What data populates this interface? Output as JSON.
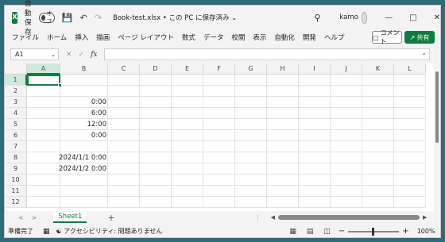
{
  "titlebar": {
    "logo": "X",
    "autosave_label": "自動保存",
    "autosave_state": "オフ",
    "doc_title": "Book-test.xlsx • この PC に保存済み ⌄",
    "user_name": "kamo"
  },
  "icons": {
    "save": "save-icon",
    "undo": "undo-icon",
    "redo": "redo-icon",
    "search": "search-icon",
    "minimize": "minimize-icon",
    "maximize": "maximize-icon",
    "close": "close-icon"
  },
  "menu": {
    "items": [
      "ファイル",
      "ホーム",
      "挿入",
      "描画",
      "ページ レイアウト",
      "数式",
      "データ",
      "校閲",
      "表示",
      "自動化",
      "開発",
      "ヘルプ"
    ],
    "comment_label": "コメント",
    "share_label": "共有"
  },
  "formula_bar": {
    "name_box": "A1",
    "fx_label": "fx",
    "content": ""
  },
  "grid": {
    "columns": [
      "A",
      "B",
      "C",
      "D",
      "E",
      "F",
      "G",
      "H",
      "I",
      "J",
      "K",
      "L"
    ],
    "rows": [
      "1",
      "2",
      "3",
      "4",
      "5",
      "6",
      "7",
      "8",
      "9",
      "10",
      "11",
      "12"
    ],
    "selected_cell": "A1",
    "cells": [
      {
        "row": 3,
        "col": "B",
        "value": "0:00"
      },
      {
        "row": 4,
        "col": "B",
        "value": "6:00"
      },
      {
        "row": 5,
        "col": "B",
        "value": "12:00"
      },
      {
        "row": 6,
        "col": "B",
        "value": "0:00"
      },
      {
        "row": 8,
        "col": "B",
        "value": "2024/1/1 0:00"
      },
      {
        "row": 9,
        "col": "B",
        "value": "2024/1/2 0:00"
      }
    ]
  },
  "sheets": {
    "tabs": [
      "Sheet1"
    ],
    "active": "Sheet1"
  },
  "status": {
    "ready": "準備完了",
    "accessibility": "アクセシビリティ: 問題ありません",
    "zoom": "100%"
  }
}
